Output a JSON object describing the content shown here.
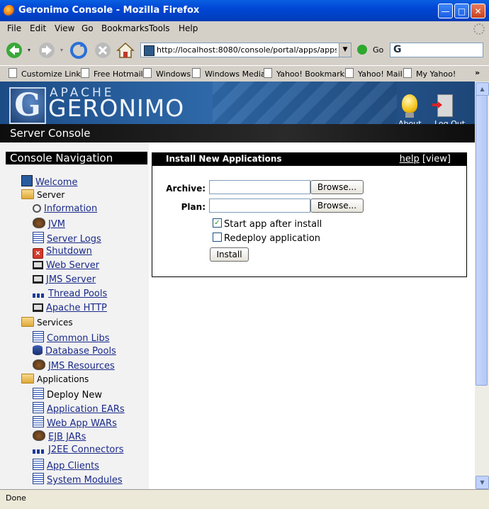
{
  "window": {
    "title": "Geronimo Console - Mozilla Firefox"
  },
  "menu": [
    "File",
    "Edit",
    "View",
    "Go",
    "Bookmarks",
    "Tools",
    "Help"
  ],
  "toolbar": {
    "url": "http://localhost:8080/console/portal/apps/apps_all",
    "go_label": "Go"
  },
  "bookmarks": [
    "Customize Links",
    "Free Hotmail",
    "Windows",
    "Windows Media",
    "Yahoo! Bookmarks",
    "Yahoo! Mail",
    "My Yahoo!"
  ],
  "banner": {
    "apache": "APACHE",
    "geronimo": "GERONIMO",
    "about": "About",
    "logout": "Log Out",
    "console": "Server Console"
  },
  "nav": {
    "header": "Console Navigation",
    "welcome": "Welcome",
    "server": "Server",
    "server_items": [
      "Information",
      "JVM",
      "Server Logs",
      "Shutdown",
      "Web Server",
      "JMS Server",
      "Thread Pools",
      "Apache HTTP"
    ],
    "services": "Services",
    "service_items": [
      "Common Libs",
      "Database Pools",
      "JMS Resources"
    ],
    "applications": "Applications",
    "deploy_new": "Deploy New",
    "app_items": [
      "Application EARs",
      "Web App WARs",
      "EJB JARs",
      "J2EE Connectors",
      "App Clients",
      "System Modules"
    ]
  },
  "install": {
    "title": "Install New Applications",
    "help": "help",
    "view": "[view]",
    "archive_label": "Archive:",
    "plan_label": "Plan:",
    "browse": "Browse...",
    "start_app": "Start app after install",
    "start_app_checked": true,
    "redeploy": "Redeploy application",
    "redeploy_checked": false,
    "install_button": "Install"
  },
  "status": {
    "text": "Done"
  }
}
